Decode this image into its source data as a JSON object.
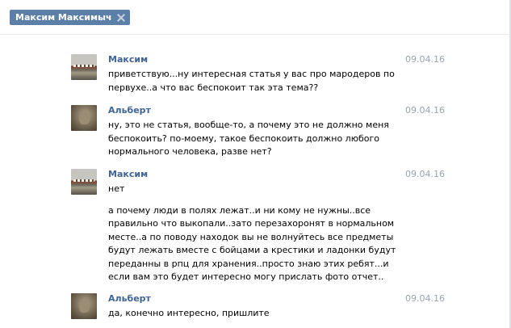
{
  "header": {
    "recipient_chip": "Максим Максимыч"
  },
  "messages": [
    {
      "author": "Максим",
      "date": "09.04.16",
      "avatar": "maxim",
      "paragraphs": [
        "приветствую...ну интересная статья у вас про мародеров по первухе..а что вас беспокоит так эта тема??"
      ]
    },
    {
      "author": "Альберт",
      "date": "09.04.16",
      "avatar": "albert",
      "paragraphs": [
        "ну, это не статья, вообще-то, а почему это не должно меня беспокоить? по-моему, такое беспокоить должно любого нормального человека, разве нет?"
      ]
    },
    {
      "author": "Максим",
      "date": "09.04.16",
      "avatar": "maxim",
      "paragraphs": [
        "нет",
        "а почему люди в полях лежат..и ни кому не нужны..все правильно что выкопали..зато перезахоронят в нормальном месте..а по поводу находок вы не волнуйтесь все предметы будут лежать вместе с бойцами а крестики и ладонки будут переданны в рпц для хранения..просто знаю этих ребят...и если вам это будет интересно могу прислать фото отчет.."
      ]
    },
    {
      "author": "Альберт",
      "date": "09.04.16",
      "avatar": "albert",
      "paragraphs": [
        "да, конечно интересно, пришлите"
      ]
    }
  ]
}
